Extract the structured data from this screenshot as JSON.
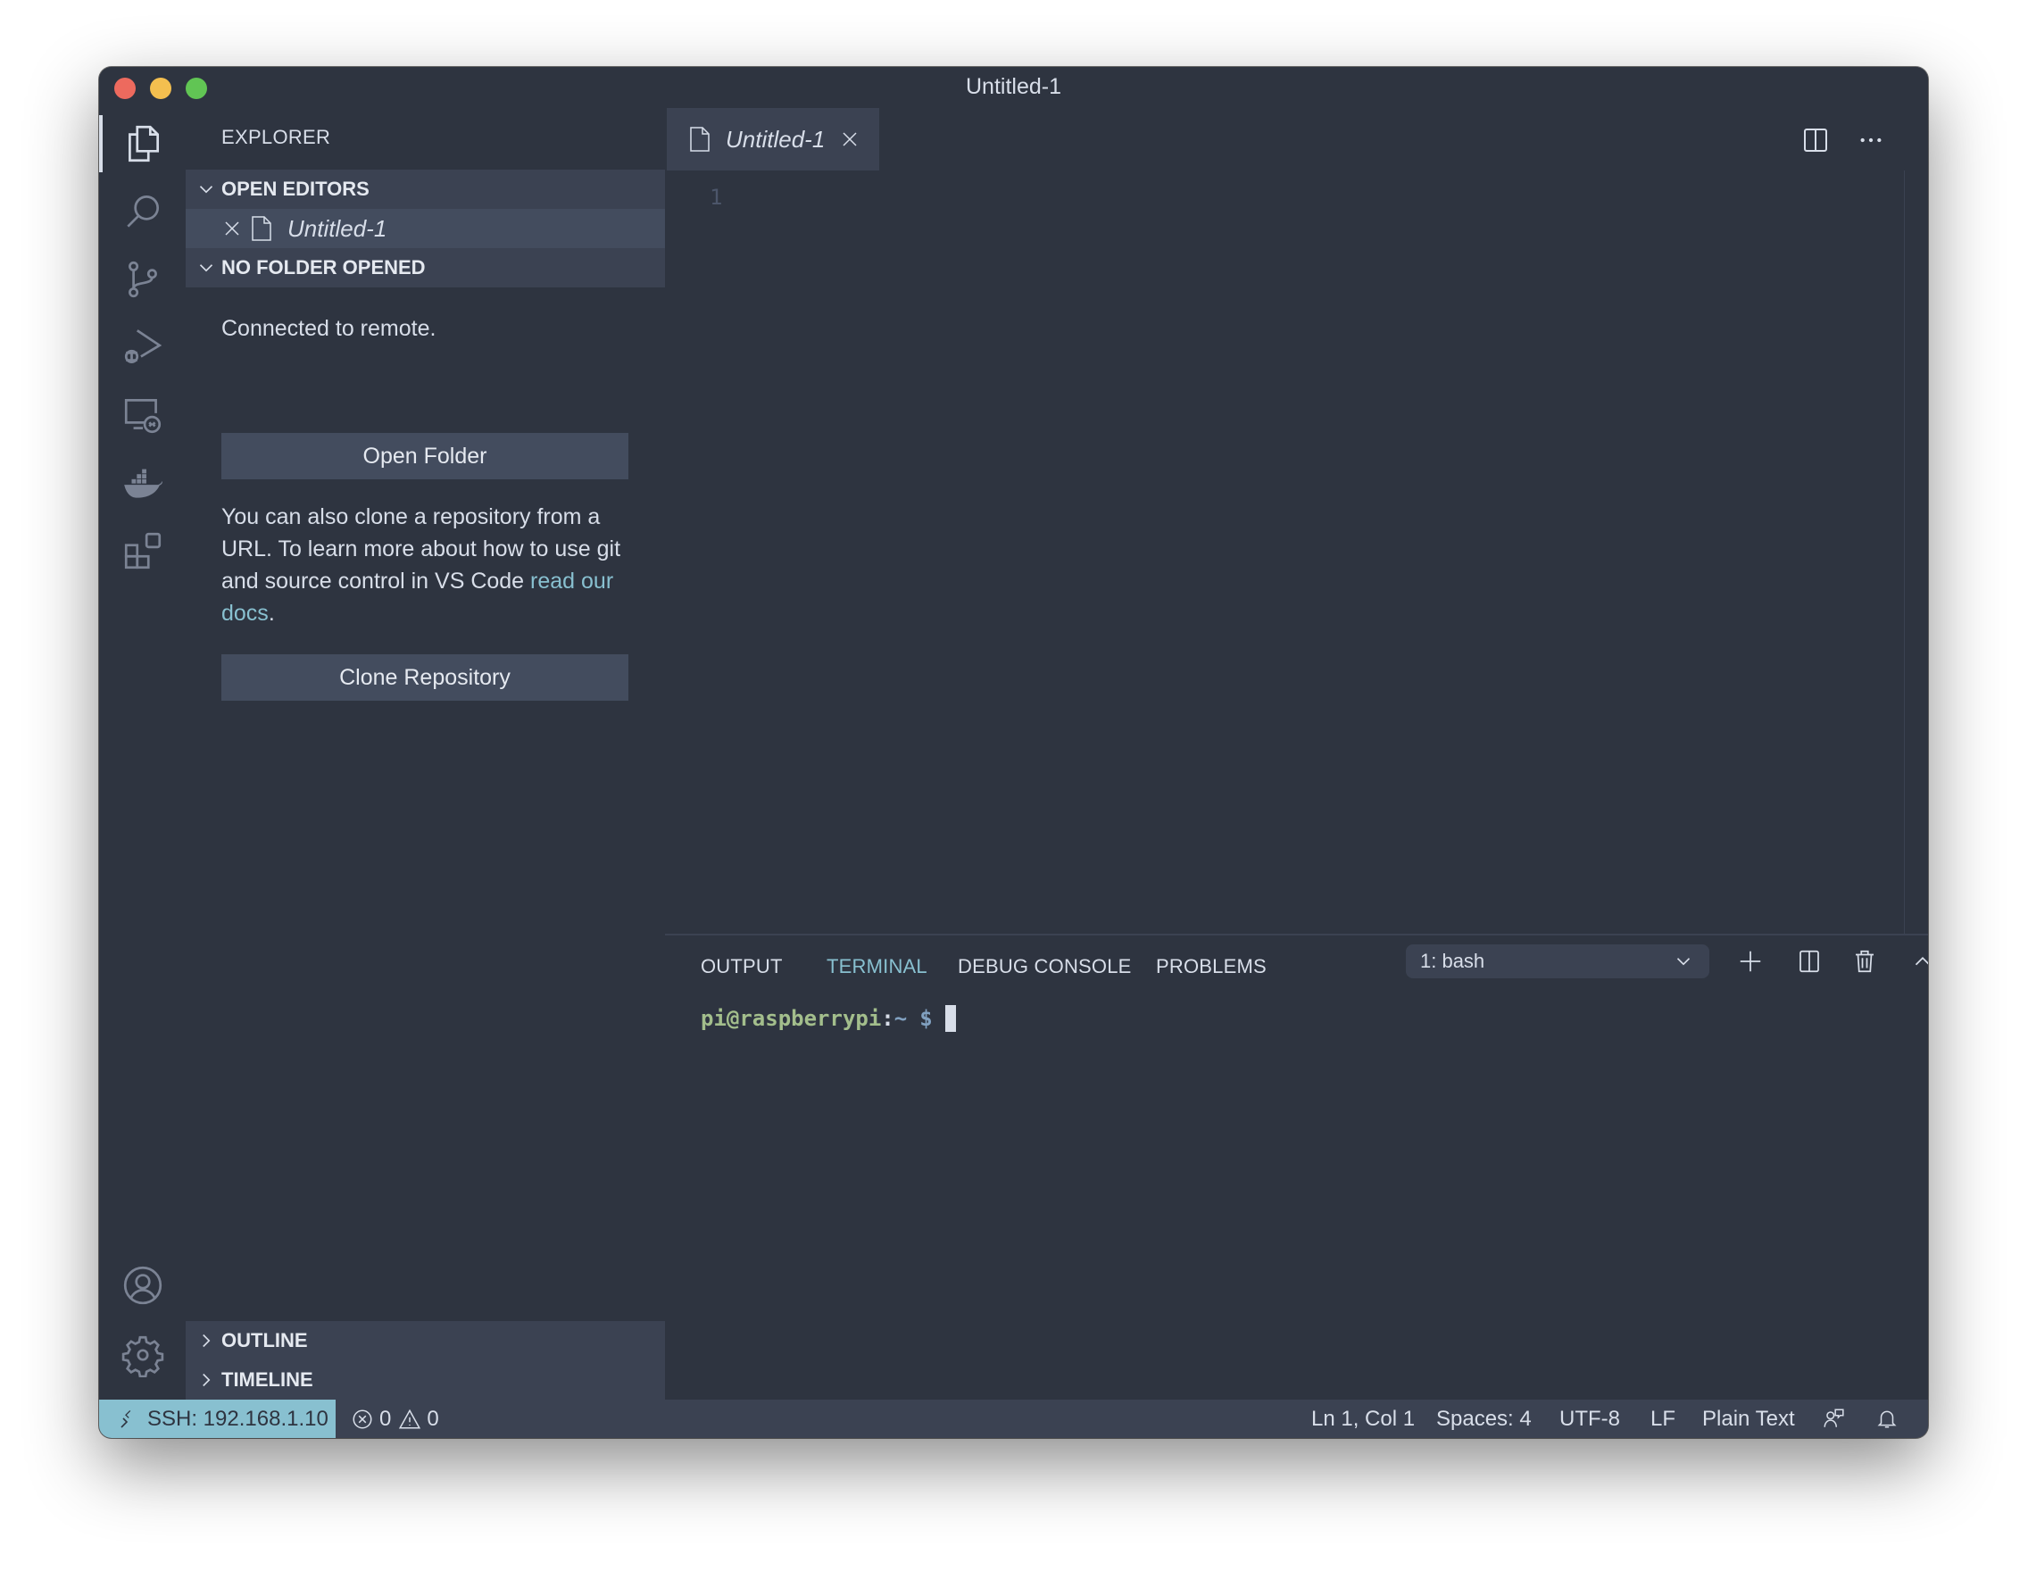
{
  "window": {
    "title": "Untitled-1"
  },
  "activity_bar": {
    "items": [
      {
        "name": "explorer",
        "icon": "files-icon",
        "active": true
      },
      {
        "name": "search",
        "icon": "search-icon"
      },
      {
        "name": "source-control",
        "icon": "source-control-icon"
      },
      {
        "name": "run-debug",
        "icon": "run-debug-icon"
      },
      {
        "name": "remote-explorer",
        "icon": "remote-explorer-icon"
      },
      {
        "name": "docker",
        "icon": "docker-icon"
      },
      {
        "name": "extensions",
        "icon": "extensions-icon"
      }
    ],
    "bottom": [
      {
        "name": "accounts",
        "icon": "account-icon"
      },
      {
        "name": "manage",
        "icon": "gear-icon"
      }
    ]
  },
  "sidebar": {
    "title": "EXPLORER",
    "open_editors": {
      "header": "OPEN EDITORS",
      "items": [
        {
          "name": "Untitled-1"
        }
      ]
    },
    "no_folder": {
      "header": "NO FOLDER OPENED",
      "connected": "Connected to remote.",
      "open_folder_label": "Open Folder",
      "clone_text": "You can also clone a repository from a URL. To learn more about how to use git and source control in VS Code ",
      "docs_link": "read our docs",
      "clone_text_end": ".",
      "clone_label": "Clone Repository"
    },
    "outline": "OUTLINE",
    "timeline": "TIMELINE"
  },
  "editor": {
    "tabs": [
      {
        "name": "Untitled-1",
        "active": true
      }
    ],
    "line_numbers": [
      "1"
    ]
  },
  "panel": {
    "tabs": [
      "OUTPUT",
      "TERMINAL",
      "DEBUG CONSOLE",
      "PROBLEMS"
    ],
    "active_tab": "TERMINAL",
    "terminal_select": "1: bash",
    "prompt": {
      "user_host": "pi@raspberrypi",
      "colon": ":",
      "path": "~",
      "symbol": "$"
    }
  },
  "status_bar": {
    "remote": "SSH: 192.168.1.10",
    "errors": "0",
    "warnings": "0",
    "position": "Ln 1, Col 1",
    "spaces": "Spaces: 4",
    "encoding": "UTF-8",
    "eol": "LF",
    "language": "Plain Text"
  },
  "colors": {
    "background": "#2e3440",
    "header": "#3b4252",
    "selection": "#434c5e",
    "accent": "#88c0d0",
    "prompt_green": "#a3be8c",
    "prompt_blue": "#81a1c1",
    "text": "#d8dee9"
  }
}
